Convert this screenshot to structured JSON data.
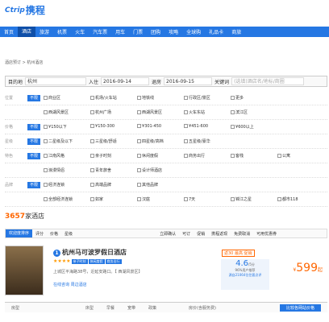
{
  "logo": {
    "top": "Ctrip",
    "cn": "携程"
  },
  "nav": [
    "首页",
    "酒店",
    "旅游",
    "机票",
    "火车",
    "汽车票",
    "用车",
    "门票",
    "团购",
    "攻略",
    "全球购",
    "礼品卡",
    "商旅"
  ],
  "crumb": "酒店预订 > 杭州酒店",
  "search": {
    "dest_label": "目的地",
    "dest": "杭州",
    "in_label": "入住",
    "in": "2016-09-14",
    "out_label": "退房",
    "out": "2016-09-15",
    "kw_label": "关键词",
    "kw_ph": "(选填)酒店名/地标/商圈"
  },
  "filters": [
    {
      "label": "位置",
      "tag": "不限",
      "opts": [
        "商业区",
        "机场/火车站",
        "地铁线",
        "行政区/景区",
        "更多"
      ]
    },
    {
      "label": "",
      "tag": "",
      "opts": [
        "西湖风景区",
        "杭州广场",
        "西湖风景区",
        "火车东站",
        "滨江区"
      ]
    },
    {
      "label": "价格",
      "tag": "不限",
      "opts": [
        "¥150以下",
        "¥150-300",
        "¥301-450",
        "¥451-600",
        "¥600以上"
      ]
    },
    {
      "label": "星级",
      "tag": "不限",
      "opts": [
        "二星级及以下",
        "三星级/舒适",
        "四星级/高档",
        "五星级/豪华"
      ]
    },
    {
      "label": "特色",
      "tag": "不限",
      "opts": [
        "江南风格",
        "亲子时刻",
        "休闲度假",
        "商务出行",
        "客栈",
        "公寓"
      ]
    },
    {
      "label": "",
      "tag": "",
      "opts": [
        "浪漫情侣",
        "青年旅舍",
        "设计师酒店"
      ]
    },
    {
      "label": "品牌",
      "tag": "不限",
      "opts": [
        "经济连锁",
        "高端品牌",
        "其他品牌"
      ]
    },
    {
      "label": "",
      "tag": "",
      "opts": [
        "全部经济连锁",
        "如家",
        "汉庭",
        "7天",
        "锦江之星",
        "都市118"
      ]
    }
  ],
  "count": {
    "num": "3657",
    "label": "家酒店"
  },
  "sort": [
    "欢迎度排序",
    "评分",
    "价格",
    "星级",
    "立即确认",
    "可订",
    "促销",
    "携程返现",
    "免费取消",
    "可用优惠券"
  ],
  "hotel": {
    "num": "1",
    "name": "杭州马可波罗假日酒店",
    "stars": "★★★★",
    "tags": [
      "亲子时刻",
      "休闲度假",
      "商务出行"
    ],
    "addr": "上城区平海路38号，近延安路口。【 西湖风景区】",
    "links": "在线咨询 周边酒店",
    "score": "4.6",
    "score_sub": "/5分",
    "pct": "96%用户推荐",
    "reviews": "源自21064位住客点评",
    "price": "599",
    "price_unit": "起",
    "promo": "返30 最高 促销"
  },
  "table": [
    "房型",
    "床型",
    "早餐",
    "宽带",
    "政策",
    "房价(含服务费)"
  ],
  "btn": "比较各网站价格"
}
